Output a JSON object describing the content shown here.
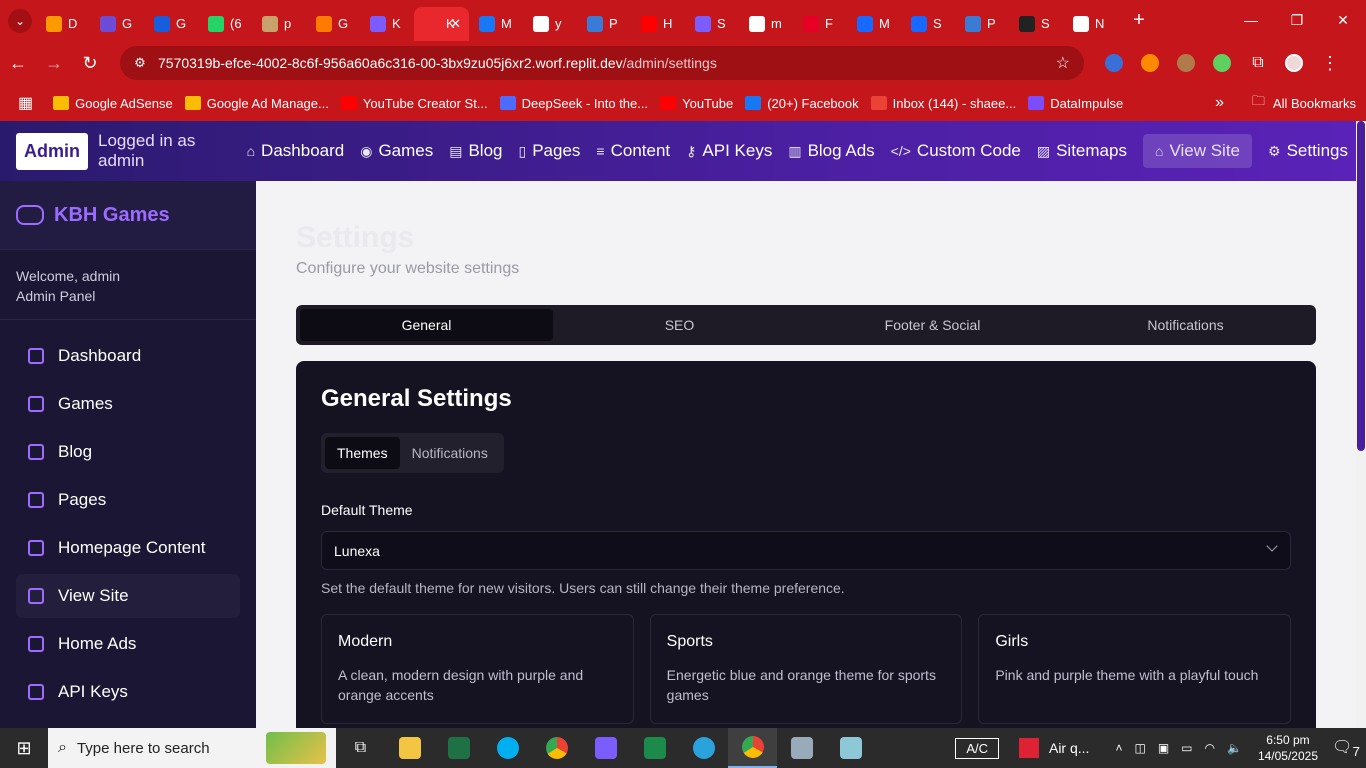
{
  "browser": {
    "tabs": [
      {
        "label": "D",
        "icon": "amazon-icon",
        "color": "#f90"
      },
      {
        "label": "G",
        "icon": "github-icon",
        "color": "#6c4cd6"
      },
      {
        "label": "G",
        "icon": "bitwarden-icon",
        "color": "#175ddc"
      },
      {
        "label": "(6",
        "icon": "whatsapp-icon",
        "color": "#25d366"
      },
      {
        "label": "p",
        "icon": "dog-icon",
        "color": "#c9a16a"
      },
      {
        "label": "G",
        "icon": "diagram-icon",
        "color": "#ff7a00"
      },
      {
        "label": "K",
        "icon": "gamepad-icon",
        "color": "#7b5cff"
      },
      {
        "label": "K",
        "icon": "kbh-icon",
        "color": "#e8282d"
      },
      {
        "label": "M",
        "icon": "meta-icon",
        "color": "#1877f2"
      },
      {
        "label": "y",
        "icon": "google-icon",
        "color": "#ffffff"
      },
      {
        "label": "P",
        "icon": "pi-icon",
        "color": "#3a7bd5"
      },
      {
        "label": "H",
        "icon": "youtube-icon",
        "color": "#ff0000"
      },
      {
        "label": "S",
        "icon": "gemini-icon",
        "color": "#7a5cff"
      },
      {
        "label": "m",
        "icon": "google-icon",
        "color": "#ffffff"
      },
      {
        "label": "F",
        "icon": "pinterest-icon",
        "color": "#e60023"
      },
      {
        "label": "M",
        "icon": "behance-icon",
        "color": "#1769ff"
      },
      {
        "label": "S",
        "icon": "behance-icon",
        "color": "#1769ff"
      },
      {
        "label": "P",
        "icon": "pi-icon",
        "color": "#3a7bd5"
      },
      {
        "label": "S",
        "icon": "gear-icon",
        "color": "#222222"
      },
      {
        "label": "N",
        "icon": "chrome-icon",
        "color": "#ffffff"
      }
    ],
    "active_tab_index": 7,
    "url_host": "7570319b-efce-4002-8c6f-956a60a6c316-00-3bx9zu05j6xr2.worf.replit.dev",
    "url_path": "/admin/settings",
    "bookmarks": [
      {
        "label": "Google AdSense",
        "color": "#fbbc04"
      },
      {
        "label": "Google Ad Manage...",
        "color": "#fbbc04"
      },
      {
        "label": "YouTube Creator St...",
        "color": "#ff0000"
      },
      {
        "label": "DeepSeek - Into the...",
        "color": "#4d6bfe"
      },
      {
        "label": "YouTube",
        "color": "#ff0000"
      },
      {
        "label": "(20+) Facebook",
        "color": "#1877f2"
      },
      {
        "label": "Inbox (144) - shaee...",
        "color": "#ea4335"
      },
      {
        "label": "DataImpulse",
        "color": "#7b4dff"
      }
    ],
    "all_bookmarks": "All Bookmarks"
  },
  "topnav": {
    "admin_label": "Admin",
    "logged_in": "Logged in as admin",
    "links": [
      {
        "label": "Dashboard",
        "icon": "home-icon"
      },
      {
        "label": "Games",
        "icon": "games-icon"
      },
      {
        "label": "Blog",
        "icon": "blog-icon"
      },
      {
        "label": "Pages",
        "icon": "pages-icon"
      },
      {
        "label": "Content",
        "icon": "content-icon"
      },
      {
        "label": "API Keys",
        "icon": "key-icon"
      },
      {
        "label": "Blog Ads",
        "icon": "ads-icon"
      },
      {
        "label": "Custom Code",
        "icon": "code-icon"
      },
      {
        "label": "Sitemaps",
        "icon": "map-icon"
      },
      {
        "label": "View Site",
        "icon": "home-icon"
      },
      {
        "label": "Settings",
        "icon": "gear-icon"
      }
    ]
  },
  "sidebar": {
    "brand": "KBH Games",
    "welcome": "Welcome, admin",
    "panel": "Admin Panel",
    "items": [
      {
        "label": "Dashboard"
      },
      {
        "label": "Games"
      },
      {
        "label": "Blog"
      },
      {
        "label": "Pages"
      },
      {
        "label": "Homepage Content"
      },
      {
        "label": "View Site"
      },
      {
        "label": "Home Ads"
      },
      {
        "label": "API Keys"
      }
    ]
  },
  "main": {
    "title": "Settings",
    "subtitle": "Configure your website settings",
    "tabs": [
      "General",
      "SEO",
      "Footer & Social",
      "Notifications"
    ],
    "card_title": "General Settings",
    "subtabs": [
      "Themes",
      "Notifications"
    ],
    "default_theme_label": "Default Theme",
    "default_theme_value": "Lunexa",
    "help_text": "Set the default theme for new visitors. Users can still change their theme preference.",
    "themes": [
      {
        "name": "Modern",
        "desc": "A clean, modern design with purple and orange accents"
      },
      {
        "name": "Sports",
        "desc": "Energetic blue and orange theme for sports games"
      },
      {
        "name": "Girls",
        "desc": "Pink and purple theme with a playful touch"
      }
    ]
  },
  "taskbar": {
    "search_placeholder": "Type here to search",
    "ac_label": "A/C",
    "air_label": "Air q...",
    "time": "6:50 pm",
    "date": "14/05/2025",
    "notif_count": "7"
  }
}
